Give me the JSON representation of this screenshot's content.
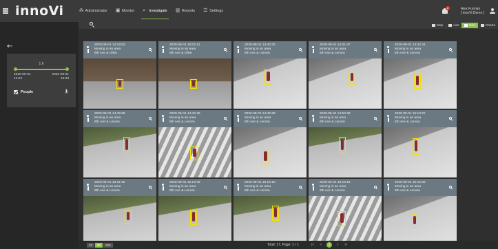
{
  "app": {
    "logo": "innoVi"
  },
  "nav": [
    {
      "label": "Administrator",
      "icon": "sitemap-icon",
      "active": false
    },
    {
      "label": "Monitor",
      "icon": "monitor-icon",
      "active": false
    },
    {
      "label": "Investigate",
      "icon": "search-icon",
      "active": true
    },
    {
      "label": "Reports",
      "icon": "chart-icon",
      "active": false
    },
    {
      "label": "Settings",
      "icon": "sliders-icon",
      "active": false
    }
  ],
  "notifications": {
    "count": "2"
  },
  "user": {
    "name": "Alex Furman",
    "org": "[ innoVi Demo ]"
  },
  "filter": {
    "time_window": "1 h",
    "start_date": "2020-09-01",
    "start_time": "14:23",
    "end_date": "2020-09-01",
    "end_time": "15:23",
    "class_label": "People",
    "class_checked": true
  },
  "view_modes": [
    {
      "label": "Map",
      "active": false
    },
    {
      "label": "List",
      "active": false
    },
    {
      "label": "Grid",
      "active": true
    },
    {
      "label": "Charts",
      "active": false
    }
  ],
  "events": [
    {
      "time": "2020-09-01 14:34:02",
      "type": "Moving in an area",
      "location": "6th Ave & Olive",
      "scene": "street"
    },
    {
      "time": "2020-09-01 15:04:12",
      "type": "Moving in an area",
      "location": "6th Ave & Olive",
      "scene": "street"
    },
    {
      "time": "2020-09-01 14:40:30",
      "type": "Moving in an area",
      "location": "6th Ave & Lenora",
      "scene": "sidewalk"
    },
    {
      "time": "2020-09-01 14:41:47",
      "type": "Moving in an area",
      "location": "6th Ave & Lenora",
      "scene": "sidewalk"
    },
    {
      "time": "2020-09-01 14:42:44",
      "type": "Moving in an area",
      "location": "6th Ave & Lenora",
      "scene": "sidewalk"
    },
    {
      "time": "2020-09-01 14:45:09",
      "type": "Moving in an area",
      "location": "6th Ave & Lenora",
      "scene": "plaza"
    },
    {
      "time": "2020-09-01 14:45:18",
      "type": "Moving in an area",
      "location": "6th Ave & Lenora",
      "scene": "crosswalk"
    },
    {
      "time": "2020-09-01 14:45:29",
      "type": "Moving in an area",
      "location": "6th Ave & Lenora",
      "scene": "sidewalk"
    },
    {
      "time": "2020-09-01 14:50:49",
      "type": "Moving in an area",
      "location": "6th Ave & Lenora",
      "scene": "plaza"
    },
    {
      "time": "2020-09-01 15:10:31",
      "type": "Moving in an area",
      "location": "6th Ave & Lenora",
      "scene": "sidewalk"
    },
    {
      "time": "2020-09-01 15:11:48",
      "type": "Moving in an area",
      "location": "6th Ave & Lenora",
      "scene": "plaza"
    },
    {
      "time": "2020-09-01 15:13:45",
      "type": "Moving in an area",
      "location": "6th Ave & Lenora",
      "scene": "plaza"
    },
    {
      "time": "2020-09-01 15:15:10",
      "type": "Moving in an area",
      "location": "6th Ave & Lenora",
      "scene": "plaza"
    },
    {
      "time": "2020-09-01 15:15:19",
      "type": "Moving in an area",
      "location": "6th Ave & Lenora",
      "scene": "crosswalk"
    },
    {
      "time": "2020-09-01 15:15:30",
      "type": "Moving in an area",
      "location": "6th Ave & Lenora",
      "scene": "sidewalk"
    }
  ],
  "pagination": {
    "page_sizes": [
      "25",
      "50",
      "100"
    ],
    "active_page_size": "50",
    "total_text": "Total: 17, Page: 1 / 1",
    "current_page": "1",
    "nav_glyphs": {
      "first": "|<",
      "prev": "<",
      "next": ">",
      "last": ">|"
    }
  },
  "colors": {
    "accent": "#8bc34a",
    "detection_box": "#f2e100",
    "card_header": "#6b7a82",
    "alert": "#e53935"
  }
}
